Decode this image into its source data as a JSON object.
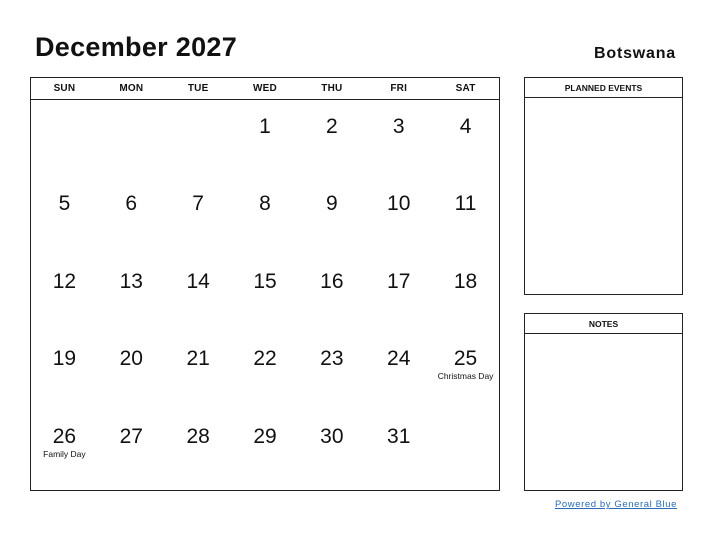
{
  "header": {
    "title": "December 2027",
    "country": "Botswana"
  },
  "calendar": {
    "weekdays": [
      "SUN",
      "MON",
      "TUE",
      "WED",
      "THU",
      "FRI",
      "SAT"
    ],
    "cells": [
      {
        "day": "",
        "event": ""
      },
      {
        "day": "",
        "event": ""
      },
      {
        "day": "",
        "event": ""
      },
      {
        "day": "1",
        "event": ""
      },
      {
        "day": "2",
        "event": ""
      },
      {
        "day": "3",
        "event": ""
      },
      {
        "day": "4",
        "event": ""
      },
      {
        "day": "5",
        "event": ""
      },
      {
        "day": "6",
        "event": ""
      },
      {
        "day": "7",
        "event": ""
      },
      {
        "day": "8",
        "event": ""
      },
      {
        "day": "9",
        "event": ""
      },
      {
        "day": "10",
        "event": ""
      },
      {
        "day": "11",
        "event": ""
      },
      {
        "day": "12",
        "event": ""
      },
      {
        "day": "13",
        "event": ""
      },
      {
        "day": "14",
        "event": ""
      },
      {
        "day": "15",
        "event": ""
      },
      {
        "day": "16",
        "event": ""
      },
      {
        "day": "17",
        "event": ""
      },
      {
        "day": "18",
        "event": ""
      },
      {
        "day": "19",
        "event": ""
      },
      {
        "day": "20",
        "event": ""
      },
      {
        "day": "21",
        "event": ""
      },
      {
        "day": "22",
        "event": ""
      },
      {
        "day": "23",
        "event": ""
      },
      {
        "day": "24",
        "event": ""
      },
      {
        "day": "25",
        "event": "Christmas Day"
      },
      {
        "day": "26",
        "event": "Family Day"
      },
      {
        "day": "27",
        "event": ""
      },
      {
        "day": "28",
        "event": ""
      },
      {
        "day": "29",
        "event": ""
      },
      {
        "day": "30",
        "event": ""
      },
      {
        "day": "31",
        "event": ""
      },
      {
        "day": "",
        "event": ""
      }
    ]
  },
  "panels": {
    "planned_events": "PLANNED EVENTS",
    "notes": "NOTES"
  },
  "footer": {
    "powered_by": "Powered by General Blue"
  }
}
